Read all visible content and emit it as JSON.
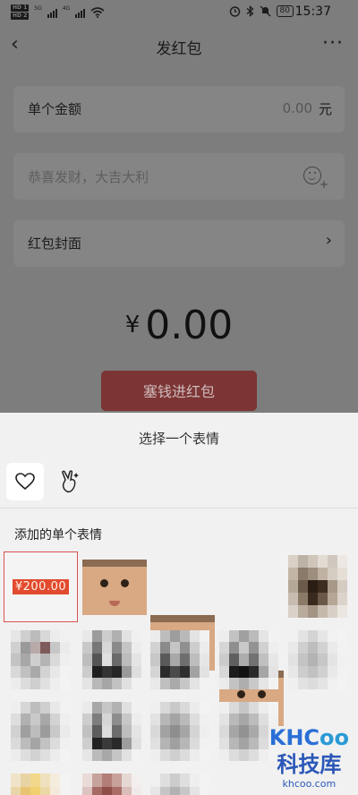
{
  "status_bar": {
    "sim1": "HD 1",
    "sim2": "HD 2",
    "net1": "5G",
    "net2": "4G",
    "battery": "80",
    "time": "15:37"
  },
  "header": {
    "title": "发红包",
    "more": "···"
  },
  "form": {
    "amount_label": "单个金额",
    "amount_value": "0.00",
    "amount_unit": "元",
    "message_placeholder": "恭喜发财，大吉大利",
    "cover_label": "红包封面"
  },
  "total": {
    "currency": "¥",
    "value": "0.00"
  },
  "send_button": "塞钱进红包",
  "sheet": {
    "title": "选择一个表情",
    "section_label": "添加的单个表情",
    "first_sticker_text": "¥200.00"
  },
  "watermark": {
    "logo_a": "KHC",
    "logo_b": "oo",
    "name": "科技库",
    "url": "khcoo.com"
  },
  "colors": {
    "accent_red": "#d9534f",
    "send_button": "#7c3434"
  },
  "icons": [
    "back-chevron-icon",
    "more-dots-icon",
    "emoji-add-icon",
    "chevron-right-icon",
    "heart-icon",
    "scissors-hand-icon",
    "alarm-icon",
    "bluetooth-icon",
    "mute-icon",
    "wifi-icon"
  ]
}
